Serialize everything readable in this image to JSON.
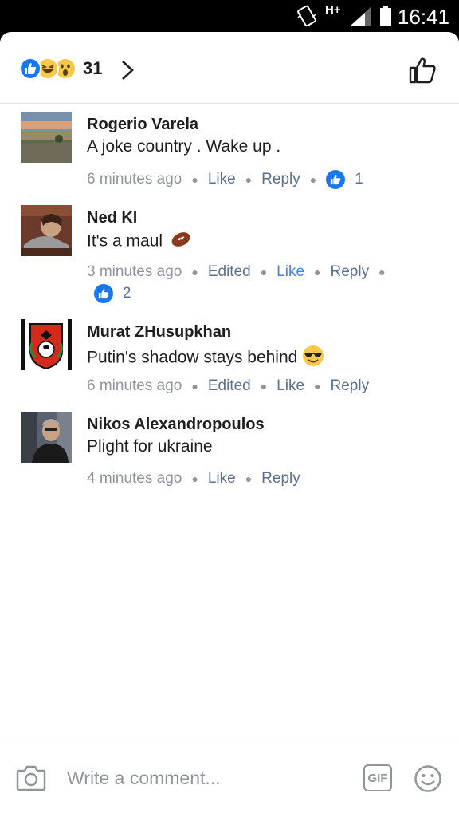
{
  "status_bar": {
    "time": "16:41",
    "network": "H+"
  },
  "header": {
    "reaction_count": "31"
  },
  "comments": [
    {
      "name": "Rogerio Varela",
      "text": "A joke country . Wake up .",
      "time": "6 minutes ago",
      "like": "Like",
      "reply": "Reply",
      "likes": "1"
    },
    {
      "name": "Ned Kl",
      "text": "It's a maul",
      "time": "3 minutes ago",
      "edited": "Edited",
      "like": "Like",
      "reply": "Reply",
      "likes": "2"
    },
    {
      "name": "Murat ZHusupkhan",
      "text": "Putin's shadow stays behind",
      "time": "6 minutes ago",
      "edited": "Edited",
      "like": "Like",
      "reply": "Reply"
    },
    {
      "name": "Nikos Alexandropoulos",
      "text": "Plight for ukraine",
      "time": "4 minutes ago",
      "like": "Like",
      "reply": "Reply"
    }
  ],
  "footer": {
    "placeholder": "Write a comment...",
    "gif_label": "GIF"
  },
  "icons": [
    "vibrate-icon",
    "signal-icon",
    "battery-icon",
    "like-reaction-icon",
    "haha-reaction-icon",
    "wow-reaction-icon",
    "chevron-right-icon",
    "thumbs-up-icon",
    "football-emoji-icon",
    "sunglasses-emoji-icon",
    "camera-icon",
    "gif-icon",
    "smiley-icon"
  ],
  "colors": {
    "like_blue": "#1877f2",
    "link_blue": "#4080ff",
    "meta_gray": "#90949c",
    "text_dark": "#1c1e21"
  }
}
